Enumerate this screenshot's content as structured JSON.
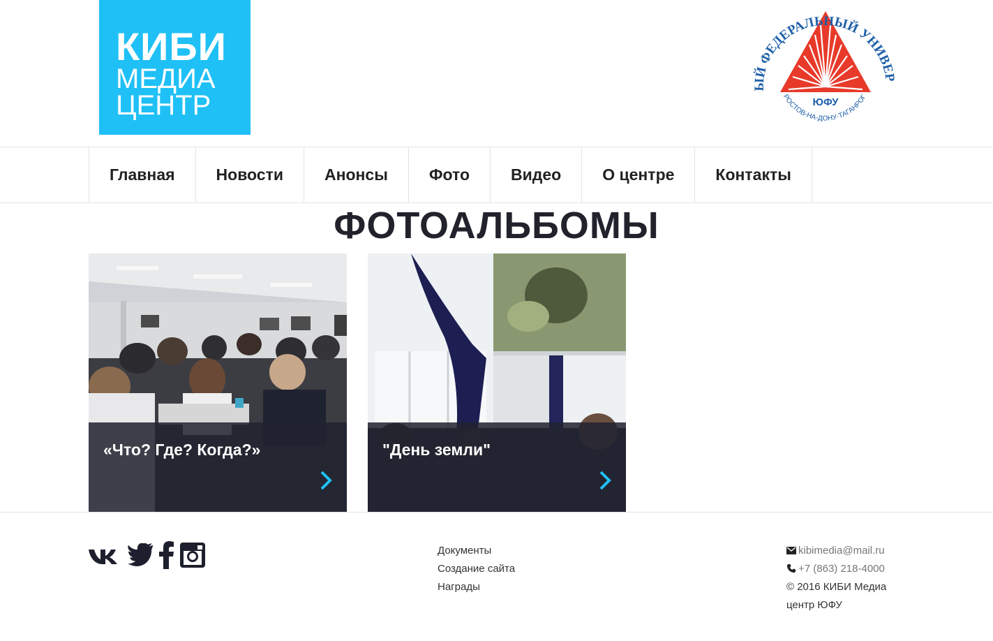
{
  "brand": {
    "line1": "КИБИ",
    "line2": "МЕДИА",
    "line3": "ЦЕНТР",
    "color": "#1fc0f5"
  },
  "university_logo": {
    "ring_text": "ЮЖНЫЙ ФЕДЕРАЛЬНЫЙ УНИВЕРСИТЕТ",
    "inner_text": "РОСТОВ-НА-ДОНУ·ТАГАНРОГ",
    "abbr": "ЮФУ",
    "colors": {
      "text": "#1f5fa8",
      "triangle": "#e83a2a"
    }
  },
  "nav": {
    "items": [
      {
        "label": "Главная"
      },
      {
        "label": "Новости"
      },
      {
        "label": "Анонсы"
      },
      {
        "label": "Фото"
      },
      {
        "label": "Видео"
      },
      {
        "label": "О центре"
      },
      {
        "label": "Контакты"
      }
    ]
  },
  "page": {
    "title": "ФОТОАЛЬБОМЫ"
  },
  "albums": [
    {
      "title": "«Что? Где? Когда?»",
      "icon": "chevron-right-icon"
    },
    {
      "title": "\"День земли\"",
      "icon": "chevron-right-icon"
    }
  ],
  "footer": {
    "social": [
      "vk-icon",
      "twitter-icon",
      "facebook-icon",
      "instagram-icon"
    ],
    "links": [
      {
        "label": "Документы"
      },
      {
        "label": "Создание сайта"
      },
      {
        "label": "Награды"
      }
    ],
    "email": "kibimedia@mail.ru",
    "phone": "+7 (863) 218-4000",
    "copyright": "© 2016 КИБИ Медиа центр ЮФУ"
  },
  "colors": {
    "accent": "#1fc0f5",
    "caption_bg": "#212330",
    "title_text": "#21222c"
  }
}
